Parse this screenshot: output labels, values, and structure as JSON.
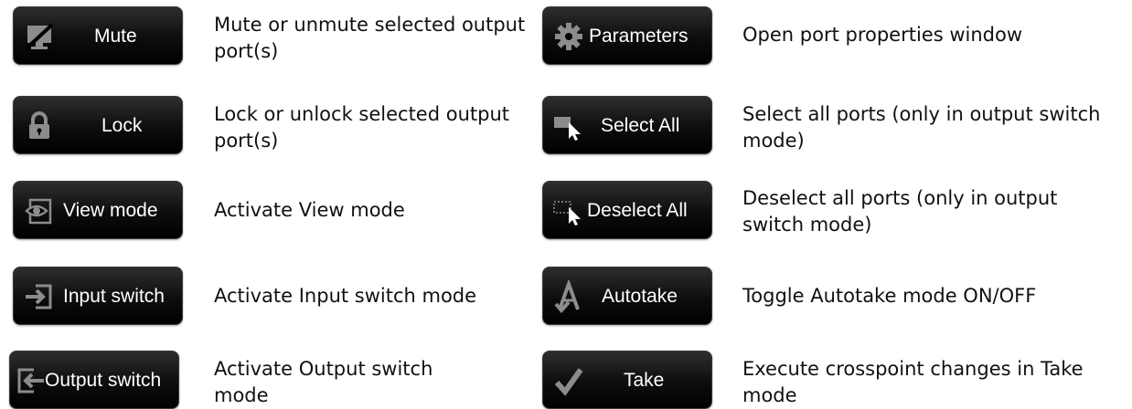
{
  "colors": {
    "button_bg": "#000000",
    "button_text": "#ffffff",
    "icon": "#8c8c8c",
    "text": "#111111"
  },
  "left": {
    "items": [
      {
        "label": "Mute",
        "icon": "mute-icon",
        "description": "Mute or unmute selected output port(s)"
      },
      {
        "label": "Lock",
        "icon": "lock-icon",
        "description": "Lock or unlock selected output port(s)"
      },
      {
        "label": "View mode",
        "icon": "eye-icon",
        "description": "Activate View mode"
      },
      {
        "label": "Input switch",
        "icon": "input-switch-icon",
        "description": "Activate Input switch mode"
      },
      {
        "label": "Output switch",
        "icon": "output-switch-icon",
        "description": "Activate Output switch mode"
      }
    ]
  },
  "right": {
    "items": [
      {
        "label": "Parameters",
        "icon": "gear-icon",
        "description": "Open port properties window"
      },
      {
        "label": "Select All",
        "icon": "select-all-icon",
        "description": "Select all ports (only in output switch mode)"
      },
      {
        "label": "Deselect All",
        "icon": "deselect-all-icon",
        "description": "Deselect all ports (only in output switch mode)"
      },
      {
        "label": "Autotake",
        "icon": "autotake-icon",
        "description": "Toggle Autotake mode ON/OFF"
      },
      {
        "label": "Take",
        "icon": "checkmark-icon",
        "description": "Execute crosspoint changes in Take mode"
      }
    ]
  }
}
